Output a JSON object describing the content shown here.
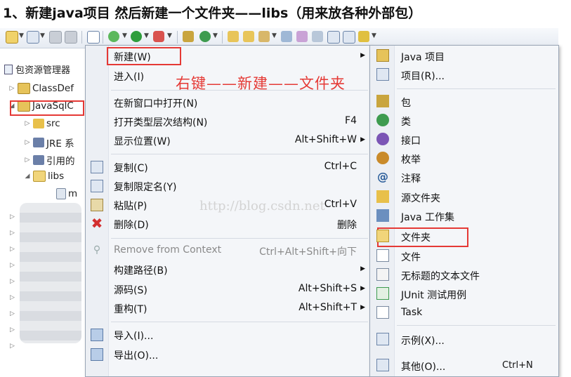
{
  "heading": "1、新建java项目 然后新建一个文件夹——libs（用来放各种外部包）",
  "explorer": {
    "title": "包资源管理器",
    "items": [
      {
        "label": "ClassDef"
      },
      {
        "label": "JavaSqlC"
      },
      {
        "label": "src"
      },
      {
        "label": "JRE 系"
      },
      {
        "label": "引用的"
      },
      {
        "label": "libs"
      },
      {
        "label": "m"
      }
    ]
  },
  "annotation": "右键——新建——文件夹",
  "watermark": "http://blog.csdn.net",
  "context_menu": {
    "items": [
      {
        "label": "新建(W)",
        "shortcut": "",
        "submenu": true
      },
      {
        "label": "进入(I)",
        "shortcut": "",
        "submenu": false
      },
      {
        "label": "在新窗口中打开(N)",
        "shortcut": "",
        "submenu": false
      },
      {
        "label": "打开类型层次结构(N)",
        "shortcut": "F4",
        "submenu": false
      },
      {
        "label": "显示位置(W)",
        "shortcut": "Alt+Shift+W",
        "submenu": true
      },
      {
        "label": "复制(C)",
        "shortcut": "Ctrl+C",
        "submenu": false
      },
      {
        "label": "复制限定名(Y)",
        "shortcut": "",
        "submenu": false
      },
      {
        "label": "粘贴(P)",
        "shortcut": "Ctrl+V",
        "submenu": false
      },
      {
        "label": "删除(D)",
        "shortcut": "删除",
        "submenu": false
      },
      {
        "label": "Remove from Context",
        "shortcut": "Ctrl+Alt+Shift+向下",
        "submenu": false,
        "disabled": true
      },
      {
        "label": "构建路径(B)",
        "shortcut": "",
        "submenu": true
      },
      {
        "label": "源码(S)",
        "shortcut": "Alt+Shift+S",
        "submenu": true
      },
      {
        "label": "重构(T)",
        "shortcut": "Alt+Shift+T",
        "submenu": true
      },
      {
        "label": "导入(I)...",
        "shortcut": "",
        "submenu": false
      },
      {
        "label": "导出(O)...",
        "shortcut": "",
        "submenu": false
      }
    ]
  },
  "submenu": {
    "items": [
      {
        "label": "Java 项目"
      },
      {
        "label": "项目(R)..."
      },
      {
        "label": "包"
      },
      {
        "label": "类"
      },
      {
        "label": "接口"
      },
      {
        "label": "枚举"
      },
      {
        "label": "注释"
      },
      {
        "label": "源文件夹"
      },
      {
        "label": "Java 工作集"
      },
      {
        "label": "文件夹"
      },
      {
        "label": "文件"
      },
      {
        "label": "无标题的文本文件"
      },
      {
        "label": "JUnit 测试用例"
      },
      {
        "label": "Task"
      },
      {
        "label": "示例(X)..."
      },
      {
        "label": "其他(O)...",
        "shortcut": "Ctrl+N"
      }
    ]
  },
  "colors": {
    "highlight_box": "#e53935",
    "annotation": "#e53935"
  }
}
